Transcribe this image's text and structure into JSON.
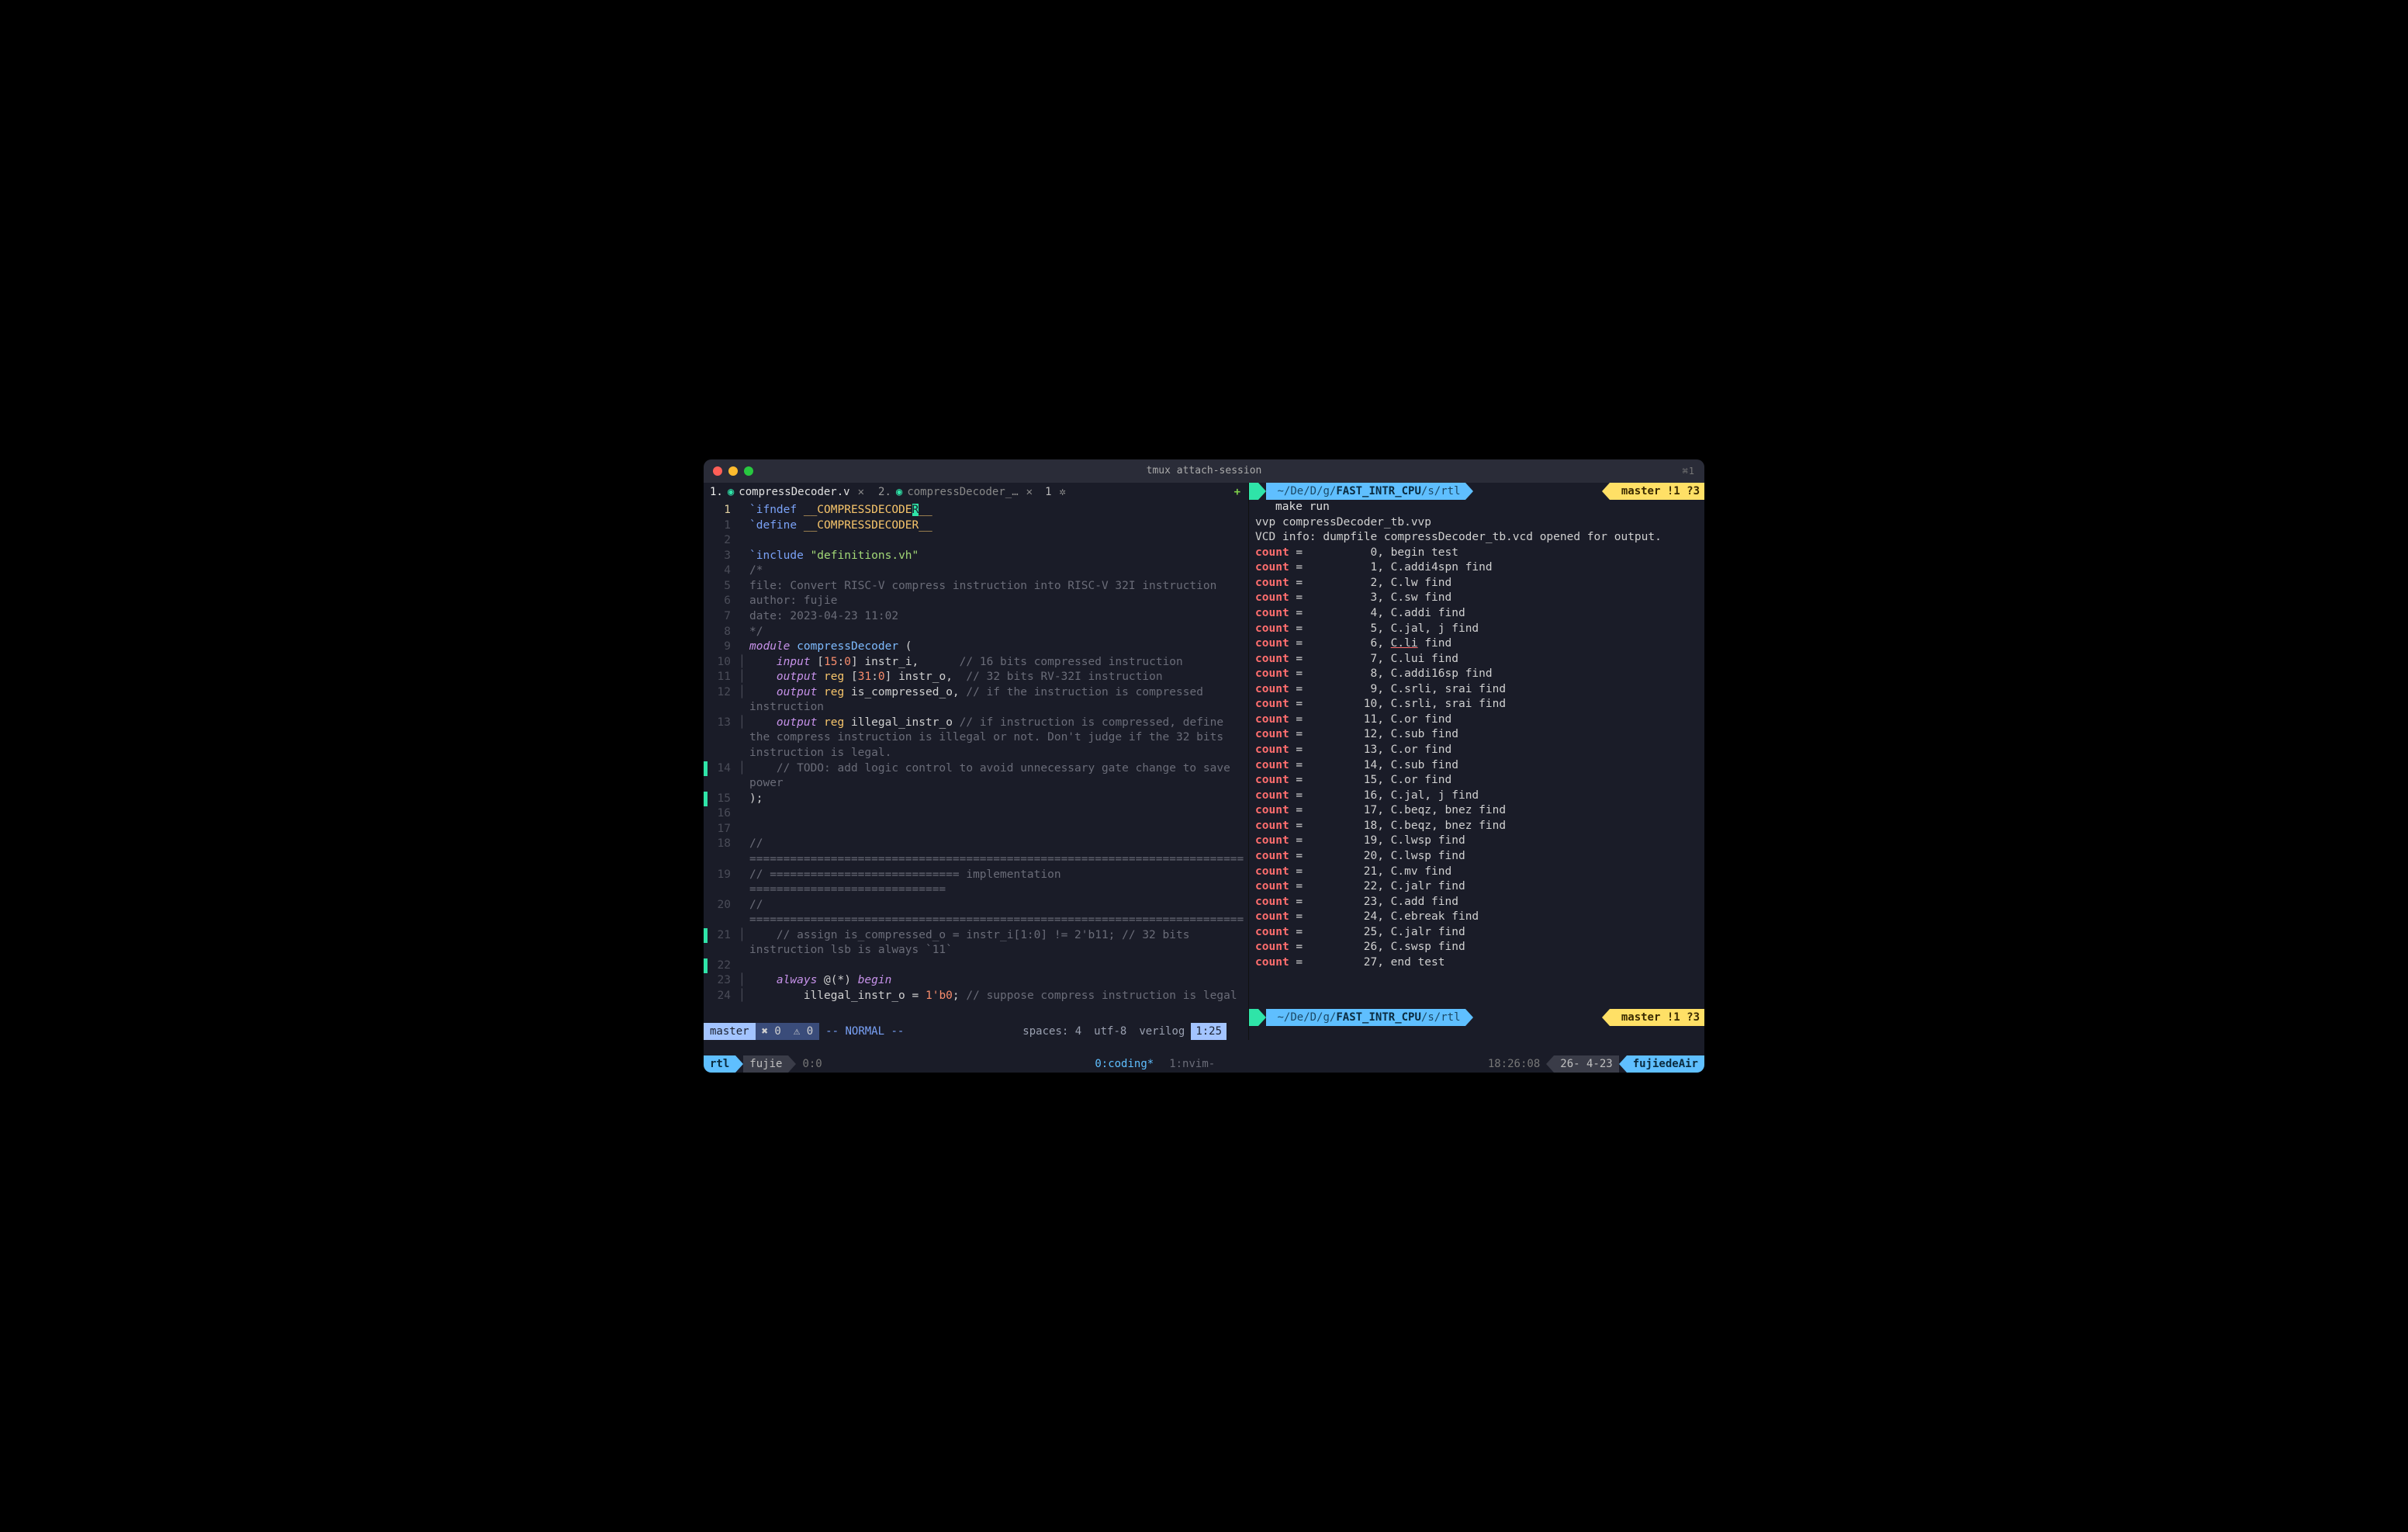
{
  "window": {
    "title": "tmux attach-session",
    "right_indicator": "⌘1"
  },
  "tabs": {
    "active": {
      "index": "1.",
      "name": "compressDecoder.v",
      "close": "✕"
    },
    "inactive": {
      "index": "2.",
      "name": "compressDecoder_…",
      "close": "✕"
    },
    "count": "1",
    "plus": "+"
  },
  "editor": {
    "gutter_first": "1",
    "lines": [
      {
        "n": "1",
        "mark": false,
        "current": true,
        "html": "<span class='c-dir'>`ifndef</span> <span class='c-def'>__COMPRESSDECODE</span><span class='c-cursor'>R</span><span class='c-def'>__</span>"
      },
      {
        "n": "1",
        "mark": false,
        "html": "<span class='c-dir'>`define</span> <span class='c-def'>__COMPRESSDECODER__</span>"
      },
      {
        "n": "2",
        "mark": false,
        "html": ""
      },
      {
        "n": "3",
        "mark": false,
        "html": "<span class='c-dir'>`include</span> <span class='c-str'>\"definitions.vh\"</span>"
      },
      {
        "n": "4",
        "mark": false,
        "html": "<span class='c-cmt'>/*</span>"
      },
      {
        "n": "5",
        "mark": false,
        "html": "<span class='c-cmt'>file: Convert RISC-V compress instruction into RISC-V 32I instruction</span>"
      },
      {
        "n": "6",
        "mark": false,
        "html": "<span class='c-cmt'>author: fujie</span>"
      },
      {
        "n": "7",
        "mark": false,
        "html": "<span class='c-cmt'>date: 2023-04-23 11:02</span>"
      },
      {
        "n": "8",
        "mark": false,
        "html": "<span class='c-cmt'>*/</span>"
      },
      {
        "n": "9",
        "mark": false,
        "html": "<span class='c-kw'>module</span> <span class='c-fn'>compressDecoder</span> ("
      },
      {
        "n": "10",
        "mark": false,
        "fold": "│",
        "html": "    <span class='c-kw'>input</span> [<span class='c-num'>15</span>:<span class='c-num'>0</span>] instr_i,      <span class='c-cmt'>// 16 bits compressed instruction</span>"
      },
      {
        "n": "11",
        "mark": false,
        "fold": "│",
        "html": "    <span class='c-kw'>output</span> <span class='c-ty'>reg</span> [<span class='c-num'>31</span>:<span class='c-num'>0</span>] instr_o,  <span class='c-cmt'>// 32 bits RV-32I instruction</span>"
      },
      {
        "n": "12",
        "mark": false,
        "fold": "│",
        "html": "    <span class='c-kw'>output</span> <span class='c-ty'>reg</span> is_compressed_o, <span class='c-cmt'>// if the instruction is compressed </span>"
      },
      {
        "n": "",
        "mark": false,
        "html": "<span class='c-cmt'>instruction</span>"
      },
      {
        "n": "13",
        "mark": false,
        "fold": "│",
        "html": "    <span class='c-kw'>output</span> <span class='c-ty'>reg</span> illegal_instr_o <span class='c-cmt'>// if instruction is compressed, define </span>"
      },
      {
        "n": "",
        "mark": false,
        "html": "<span class='c-cmt'>the compress instruction is illegal or not. Don't judge if the 32 bits </span>"
      },
      {
        "n": "",
        "mark": false,
        "html": "<span class='c-cmt'>instruction is legal.</span>"
      },
      {
        "n": "14",
        "mark": true,
        "fold": "│",
        "html": "    <span class='c-cmt'>// TODO: add logic control to avoid unnecessary gate change to save </span>"
      },
      {
        "n": "",
        "mark": false,
        "html": "<span class='c-cmt'>power</span>"
      },
      {
        "n": "15",
        "mark": true,
        "html": ");"
      },
      {
        "n": "16",
        "mark": false,
        "html": ""
      },
      {
        "n": "17",
        "mark": false,
        "html": ""
      },
      {
        "n": "18",
        "mark": false,
        "html": "<span class='c-cmt'>// </span>"
      },
      {
        "n": "",
        "mark": false,
        "html": "<span class='c-cmt'>=========================================================================</span>"
      },
      {
        "n": "19",
        "mark": false,
        "html": "<span class='c-cmt'>// ============================ implementation </span>"
      },
      {
        "n": "",
        "mark": false,
        "html": "<span class='c-cmt'>=============================</span>"
      },
      {
        "n": "20",
        "mark": false,
        "html": "<span class='c-cmt'>// </span>"
      },
      {
        "n": "",
        "mark": false,
        "html": "<span class='c-cmt'>=========================================================================</span>"
      },
      {
        "n": "21",
        "mark": true,
        "fold": "│",
        "html": "    <span class='c-cmt'>// assign is_compressed_o = instr_i[1:0] != 2'b11; // 32 bits </span>"
      },
      {
        "n": "",
        "mark": false,
        "html": "<span class='c-cmt'>instruction lsb is always `11`</span>"
      },
      {
        "n": "22",
        "mark": true,
        "html": ""
      },
      {
        "n": "23",
        "mark": false,
        "fold": "│",
        "html": "    <span class='c-kw'>always</span> @(*) <span class='c-kw'>begin</span>"
      },
      {
        "n": "24",
        "mark": false,
        "fold": "│",
        "html": "        illegal_instr_o = <span class='c-num'>1'b0</span>; <span class='c-cmt'>// suppose compress instruction is legal</span>"
      }
    ]
  },
  "statusline": {
    "branch": " master",
    "errors": "✖ 0",
    "warnings": "⚠ 0",
    "mode": "-- NORMAL --",
    "indent": "spaces: 4",
    "encoding": "utf-8",
    "filetype": "verilog",
    "position": "1:25"
  },
  "terminal": {
    "prompt": {
      "apple": "",
      "path_muted": "~/De/D/g/",
      "path_bold": "FAST_INTR_CPU",
      "path_tail": "/s/rtl",
      "git_icon": " ",
      "git_branch": "master",
      "git_status": " !1 ?3"
    },
    "cmd": "make run",
    "lines": [
      "vvp compressDecoder_tb.vvp",
      "VCD info: dumpfile compressDecoder_tb.vcd opened for output."
    ],
    "counts": [
      {
        "n": "0",
        "msg": "begin test"
      },
      {
        "n": "1",
        "msg": "C.addi4spn find"
      },
      {
        "n": "2",
        "msg": "C.lw find"
      },
      {
        "n": "3",
        "msg": "C.sw find"
      },
      {
        "n": "4",
        "msg": "C.addi find"
      },
      {
        "n": "5",
        "msg": "C.jal, j find"
      },
      {
        "n": "6",
        "msg": "C.li find",
        "underline_first": "C.li"
      },
      {
        "n": "7",
        "msg": "C.lui find"
      },
      {
        "n": "8",
        "msg": "C.addi16sp find"
      },
      {
        "n": "9",
        "msg": "C.srli, srai find"
      },
      {
        "n": "10",
        "msg": "C.srli, srai find"
      },
      {
        "n": "11",
        "msg": "C.or find"
      },
      {
        "n": "12",
        "msg": "C.sub find"
      },
      {
        "n": "13",
        "msg": "C.or find"
      },
      {
        "n": "14",
        "msg": "C.sub find"
      },
      {
        "n": "15",
        "msg": "C.or find"
      },
      {
        "n": "16",
        "msg": "C.jal, j find"
      },
      {
        "n": "17",
        "msg": "C.beqz, bnez find"
      },
      {
        "n": "18",
        "msg": "C.beqz, bnez find"
      },
      {
        "n": "19",
        "msg": "C.lwsp find"
      },
      {
        "n": "20",
        "msg": "C.lwsp find"
      },
      {
        "n": "21",
        "msg": "C.mv find"
      },
      {
        "n": "22",
        "msg": "C.jalr find"
      },
      {
        "n": "23",
        "msg": "C.add find"
      },
      {
        "n": "24",
        "msg": "C.ebreak find"
      },
      {
        "n": "25",
        "msg": "C.jalr find"
      },
      {
        "n": "26",
        "msg": "C.swsp find"
      },
      {
        "n": "27",
        "msg": "end test"
      }
    ]
  },
  "tmux": {
    "session": "rtl",
    "user": "fujie",
    "pane": "0:0",
    "windows": [
      {
        "label": "0:coding*",
        "active": true
      },
      {
        "label": "1:nvim-",
        "active": false
      }
    ],
    "time": "18:26:08",
    "date": "26- 4-23",
    "host": "fujiedeAir"
  }
}
